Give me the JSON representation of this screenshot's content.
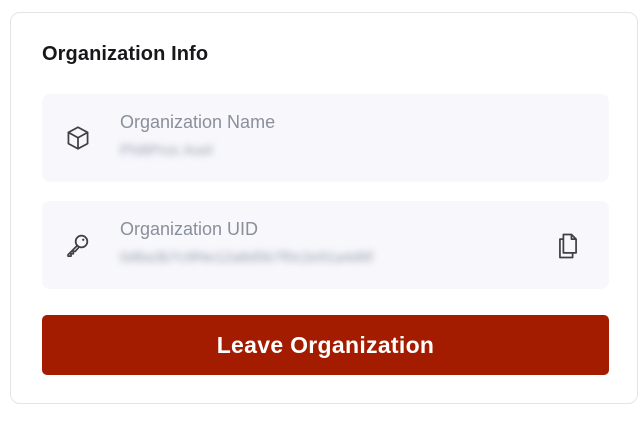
{
  "card": {
    "title": "Organization Info"
  },
  "organization_name": {
    "label": "Organization Name",
    "value": "PhiltProc Axel",
    "icon": "cube-icon"
  },
  "organization_uid": {
    "label": "Organization UID",
    "value": "0d6a3b7c9f4e12a8d5b7f0c2e91a4d6f",
    "icon": "key-icon",
    "copy_icon": "copy-icon"
  },
  "actions": {
    "leave_label": "Leave Organization"
  },
  "colors": {
    "danger": "#a31c00",
    "row_background": "#f7f7fc",
    "label_text": "#8a8f9c"
  }
}
